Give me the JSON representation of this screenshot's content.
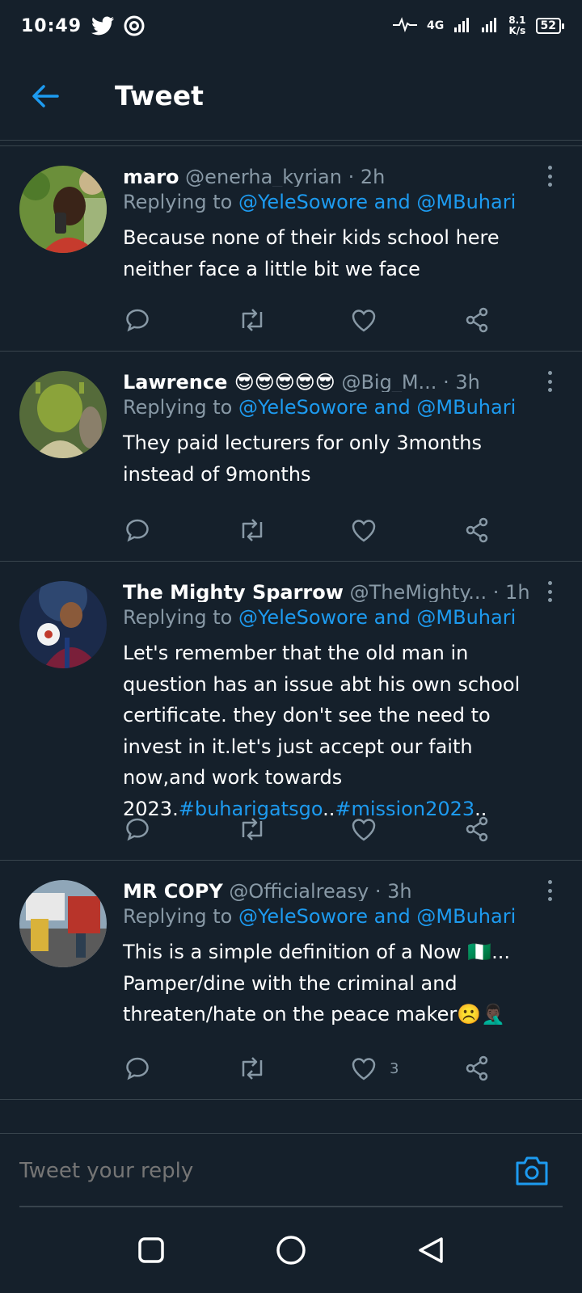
{
  "status_bar": {
    "time": "10:49",
    "network": "4G",
    "speed_value": "8.1",
    "speed_unit": "K/s",
    "battery": "52"
  },
  "header": {
    "title": "Tweet"
  },
  "tweets": [
    {
      "name": "maro",
      "handle": "@enerha_kyrian",
      "age": "2h",
      "replying_prefix": "Replying to",
      "mention1": "@YeleSowore",
      "and": "and",
      "mention2": "@MBuhari",
      "text": "Because none of their kids school here neither face a little bit we face",
      "likes": ""
    },
    {
      "name": "Lawrence 😎😎😎😎😎",
      "handle": "@Big_M...",
      "age": "3h",
      "replying_prefix": "Replying to",
      "mention1": "@YeleSowore",
      "and": "and",
      "mention2": "@MBuhari",
      "text": "They paid lecturers for only 3months instead of 9months",
      "likes": ""
    },
    {
      "name": "The Mighty Sparrow",
      "handle": "@TheMighty...",
      "age": "1h",
      "replying_prefix": "Replying to",
      "mention1": "@YeleSowore",
      "and": "and",
      "mention2": "@MBuhari",
      "text": "Let's remember that the old man in question has an issue abt his own school certificate. they don't see the need to invest in it.let's just accept our faith now,and work towards 2023.",
      "hashtag1": "#buharigatsgo",
      "sep": "..",
      "hashtag2": "#mission2023",
      "tail": "..",
      "likes": ""
    },
    {
      "name": "MR COPY",
      "handle": "@Officialreasy",
      "age": "3h",
      "replying_prefix": "Replying to",
      "mention1": "@YeleSowore",
      "and": "and",
      "mention2": "@MBuhari",
      "text": "This is a simple definition of a Now 🇳🇬... Pamper/dine with the criminal and threaten/hate on the peace maker☹️🤦🏿‍♂️",
      "likes": "3"
    }
  ],
  "reply": {
    "placeholder": "Tweet your reply"
  },
  "colors": {
    "background": "#15202b",
    "accent": "#1d9bf0",
    "muted": "#8899a6",
    "divider": "#38444d"
  },
  "icons": {
    "back": "arrow-left-icon",
    "more": "kebab-icon",
    "reply": "comment-icon",
    "retweet": "retweet-icon",
    "like": "heart-icon",
    "share": "share-icon",
    "camera": "camera-icon",
    "nav_recents": "square-icon",
    "nav_home": "circle-icon",
    "nav_back": "triangle-icon"
  }
}
